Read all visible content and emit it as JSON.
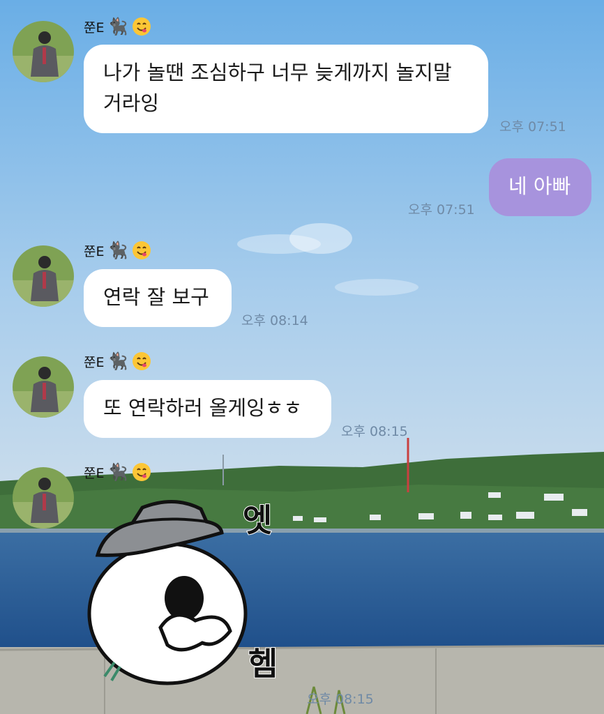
{
  "chat": {
    "messages": [
      {
        "sender": "쭌E",
        "sender_emoji": "🐈‍⬛",
        "text": "나가 놀땐 조심하구 너무 늦게까지 놀지말 거라잉",
        "time": "오후 07:51"
      },
      {
        "sender": "me",
        "text": "네 아빠",
        "time": "오후 07:51"
      },
      {
        "sender": "쭌E",
        "sender_emoji": "🐈‍⬛",
        "text": "연락 잘 보구",
        "time": "오후 08:14"
      },
      {
        "sender": "쭌E",
        "sender_emoji": "🐈‍⬛",
        "text": "또 연락하러 올게잉ㅎㅎ",
        "time": "오후 08:15"
      },
      {
        "sender": "쭌E",
        "sender_emoji": "🐈‍⬛",
        "sticker_text_1": "엣",
        "sticker_text_2": "헴",
        "time": "오후 08:15"
      }
    ]
  },
  "colors": {
    "my_bubble": "#a793dd",
    "their_bubble": "#ffffff",
    "time_text": "#6f8aa6"
  },
  "icons": {
    "avatar": "profile-photo",
    "smile": "smiling-face-icon",
    "cat": "black-cat-emoji"
  }
}
